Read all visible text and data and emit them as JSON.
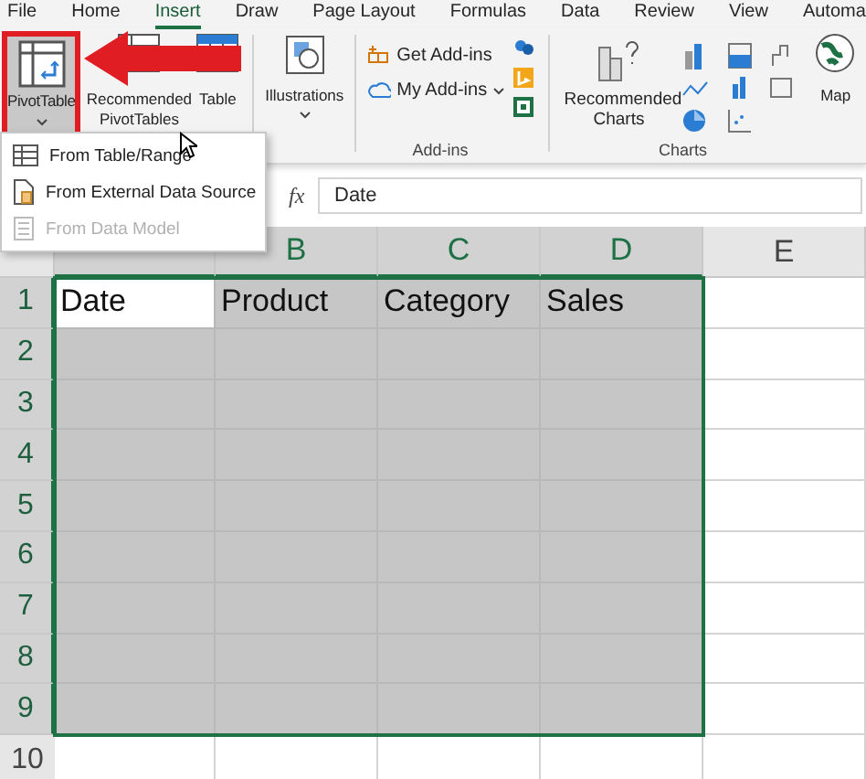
{
  "tabs": [
    {
      "label": "File",
      "selected": false
    },
    {
      "label": "Home",
      "selected": false
    },
    {
      "label": "Insert",
      "selected": true
    },
    {
      "label": "Draw",
      "selected": false
    },
    {
      "label": "Page Layout",
      "selected": false
    },
    {
      "label": "Formulas",
      "selected": false
    },
    {
      "label": "Data",
      "selected": false
    },
    {
      "label": "Review",
      "selected": false
    },
    {
      "label": "View",
      "selected": false
    },
    {
      "label": "Automa",
      "selected": false
    }
  ],
  "ribbon": {
    "pivot_table": {
      "label": "PivotTable",
      "selected": true
    },
    "recommended_pivot_tables": "Recommended PivotTables",
    "table": "Table",
    "illustrations": "Illustrations",
    "addins": {
      "items": [
        "Get Add-ins",
        "My Add-ins"
      ],
      "group_label": "Add-ins"
    },
    "recommended_charts": "Recommended Charts",
    "charts_group_label": "Charts",
    "maps": "Map"
  },
  "menu": {
    "items": [
      {
        "label": "From Table/Range",
        "disabled": false
      },
      {
        "label": "From External Data Source",
        "disabled": false
      },
      {
        "label": "From Data Model",
        "disabled": true
      }
    ]
  },
  "formula_bar": {
    "fx": "fx",
    "value": "Date"
  },
  "sheet": {
    "columns": [
      {
        "selected": true
      },
      {
        "label": "B",
        "selected": true
      },
      {
        "label": "C",
        "selected": true
      },
      {
        "label": "D",
        "selected": true
      },
      {
        "label": "E",
        "selected": false
      }
    ],
    "rows": [
      {
        "label": "1",
        "selected": true,
        "cells": [
          "Date",
          "Product",
          "Category",
          "Sales"
        ]
      },
      {
        "label": "2",
        "selected": true
      },
      {
        "label": "3",
        "selected": true
      },
      {
        "label": "4",
        "selected": true
      },
      {
        "label": "5",
        "selected": true
      },
      {
        "label": "6",
        "selected": true
      },
      {
        "label": "7",
        "selected": true
      },
      {
        "label": "8",
        "selected": true
      },
      {
        "label": "9",
        "selected": true
      },
      {
        "label": "10",
        "selected": false
      }
    ]
  }
}
